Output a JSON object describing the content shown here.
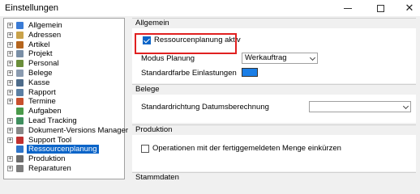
{
  "window": {
    "title": "Einstellungen"
  },
  "tree": {
    "items": [
      {
        "label": "Allgemein",
        "expander": "+",
        "icon_color": "#3a7bd5",
        "icon": "settings-icon"
      },
      {
        "label": "Adressen",
        "expander": "+",
        "icon_color": "#c9a24a",
        "icon": "address-book-icon"
      },
      {
        "label": "Artikel",
        "expander": "+",
        "icon_color": "#b5651d",
        "icon": "article-icon"
      },
      {
        "label": "Projekt",
        "expander": "+",
        "icon_color": "#7a8fa6",
        "icon": "project-icon"
      },
      {
        "label": "Personal",
        "expander": "+",
        "icon_color": "#6a8e3a",
        "icon": "person-icon"
      },
      {
        "label": "Belege",
        "expander": "+",
        "icon_color": "#8a9bb0",
        "icon": "document-icon"
      },
      {
        "label": "Kasse",
        "expander": "+",
        "icon_color": "#4d6b8a",
        "icon": "cash-register-icon"
      },
      {
        "label": "Rapport",
        "expander": "+",
        "icon_color": "#5b7fa3",
        "icon": "report-icon"
      },
      {
        "label": "Termine",
        "expander": "+",
        "icon_color": "#c8502d",
        "icon": "calendar-icon"
      },
      {
        "label": "Aufgaben",
        "expander": "",
        "icon_color": "#4a9a4a",
        "icon": "tasks-icon"
      },
      {
        "label": "Lead Tracking",
        "expander": "+",
        "icon_color": "#3f8f5e",
        "icon": "lead-icon"
      },
      {
        "label": "Dokument-Versions Manager",
        "expander": "+",
        "icon_color": "#888888",
        "icon": "versions-icon"
      },
      {
        "label": "Support Tool",
        "expander": "+",
        "icon_color": "#c03030",
        "icon": "support-icon"
      },
      {
        "label": "Ressourcenplanung",
        "expander": "",
        "icon_color": "#2e75c9",
        "icon": "resource-planning-icon"
      },
      {
        "label": "Produktion",
        "expander": "+",
        "icon_color": "#6b6b6b",
        "icon": "production-icon"
      },
      {
        "label": "Reparaturen",
        "expander": "+",
        "icon_color": "#7d7d7d",
        "icon": "repair-icon"
      }
    ],
    "selected": "Ressourcenplanung"
  },
  "allgemein": {
    "header": "Allgemein",
    "ressourcenplanung_checkbox": "Ressourcenplanung aktiv",
    "modus_label": "Modus Planung",
    "modus_value": "Werkauftrag",
    "standardfarbe_label": "Standardfarbe Einlastungen",
    "standardfarbe_color": "#1a7ee6"
  },
  "belege": {
    "header": "Belege",
    "standardrichtung_label": "Standardrichtung Datumsberechnung",
    "standardrichtung_value": ""
  },
  "produktion": {
    "header": "Produktion",
    "operationen_checkbox": "Operationen mit der fertiggemeldeten Menge einkürzen"
  },
  "stammdaten": {
    "header": "Stammdaten"
  }
}
